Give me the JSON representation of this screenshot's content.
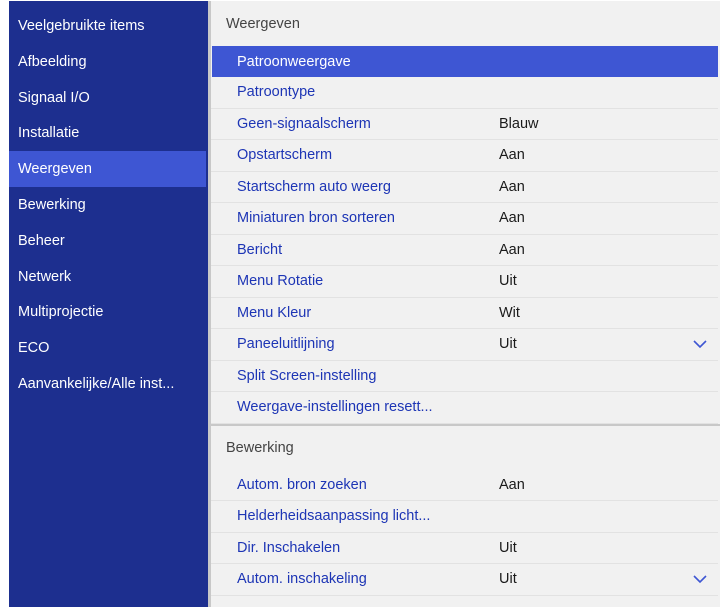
{
  "sidebar": {
    "items": [
      {
        "label": "Veelgebruikte items"
      },
      {
        "label": "Afbeelding"
      },
      {
        "label": "Signaal I/O"
      },
      {
        "label": "Installatie"
      },
      {
        "label": "Weergeven"
      },
      {
        "label": "Bewerking"
      },
      {
        "label": "Beheer"
      },
      {
        "label": "Netwerk"
      },
      {
        "label": "Multiprojectie"
      },
      {
        "label": "ECO"
      },
      {
        "label": "Aanvankelijke/Alle inst..."
      }
    ],
    "active_index": 4
  },
  "sections": [
    {
      "header": "Weergeven",
      "rows": [
        {
          "label": "Patroonweergave",
          "value": ""
        },
        {
          "label": "Patroontype",
          "value": ""
        },
        {
          "label": "Geen-signaalscherm",
          "value": "Blauw"
        },
        {
          "label": "Opstartscherm",
          "value": "Aan"
        },
        {
          "label": "Startscherm auto weerg",
          "value": "Aan"
        },
        {
          "label": "Miniaturen bron sorteren",
          "value": "Aan"
        },
        {
          "label": "Bericht",
          "value": "Aan"
        },
        {
          "label": "Menu Rotatie",
          "value": "Uit"
        },
        {
          "label": "Menu Kleur",
          "value": "Wit"
        },
        {
          "label": "Paneeluitlijning",
          "value": "Uit"
        },
        {
          "label": "Split Screen-instelling",
          "value": ""
        },
        {
          "label": "Weergave-instellingen resett...",
          "value": ""
        }
      ]
    },
    {
      "header": "Bewerking",
      "rows": [
        {
          "label": "Autom. bron zoeken",
          "value": "Aan"
        },
        {
          "label": "Helderheidsaanpassing licht...",
          "value": ""
        },
        {
          "label": "Dir. Inschakelen",
          "value": "Uit"
        },
        {
          "label": "Autom. inschakeling",
          "value": "Uit"
        }
      ]
    }
  ],
  "colors": {
    "sidebar_bg": "#1d2f8f",
    "highlight": "#3e56d3",
    "item_text": "#1d35b5",
    "panel_bg": "#f1f1f1"
  }
}
